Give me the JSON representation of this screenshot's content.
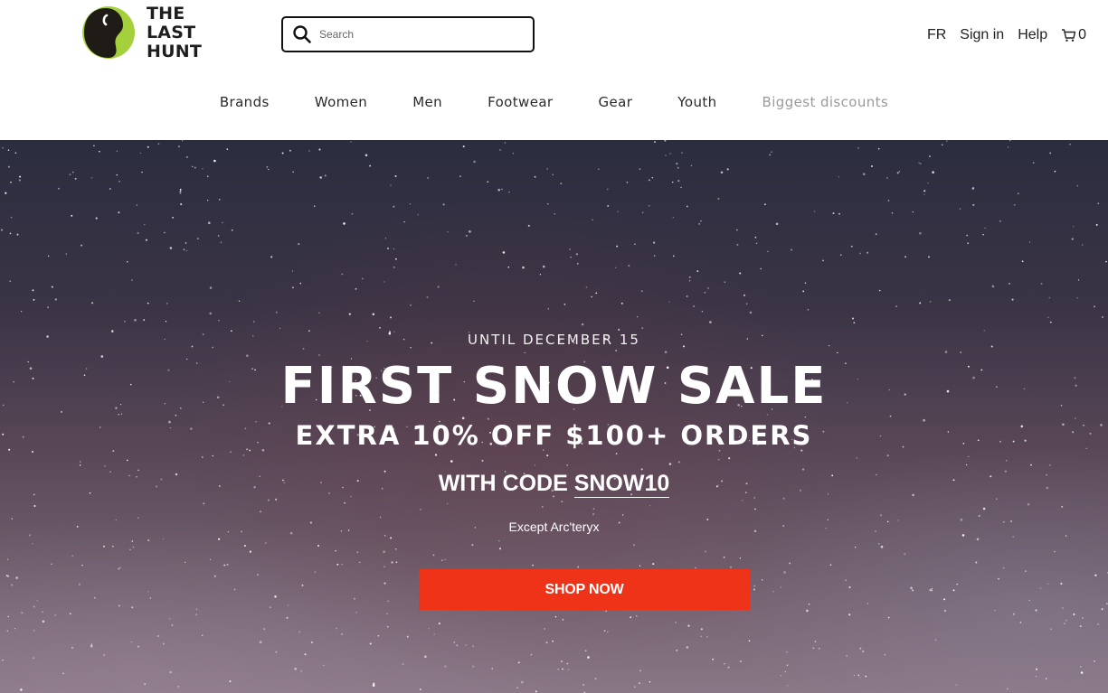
{
  "brand": {
    "name_line1": "THE LAST",
    "name_line2": "HUNT"
  },
  "search": {
    "placeholder": "Search"
  },
  "utility": {
    "language": "FR",
    "sign_in": "Sign in",
    "help": "Help",
    "cart_count": "0"
  },
  "nav": {
    "items": [
      "Brands",
      "Women",
      "Men",
      "Footwear",
      "Gear",
      "Youth",
      "Biggest discounts"
    ]
  },
  "hero": {
    "eyebrow": "UNTIL DECEMBER 15",
    "title": "FIRST SNOW SALE",
    "subtitle": "EXTRA 10% OFF $100+ ORDERS",
    "code_prefix": "WITH CODE",
    "code": "SNOW10",
    "note": "Except Arc'teryx",
    "cta": "SHOP NOW"
  },
  "colors": {
    "accent_green": "#9acd32",
    "cta_red": "#ee3318",
    "nav_muted": "#9a9a9a"
  }
}
